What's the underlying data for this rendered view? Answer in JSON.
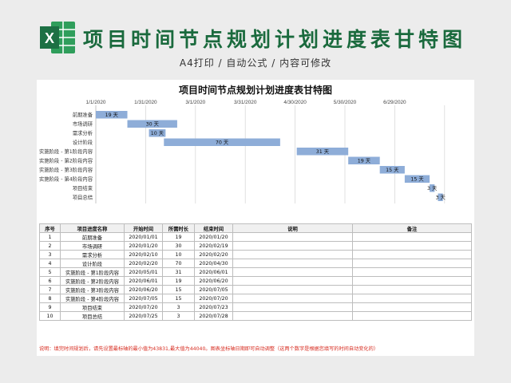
{
  "header": {
    "title": "项目时间节点规划计划进度表甘特图",
    "subtitle": "A4打印 / 自动公式 / 内容可修改",
    "logo_letter": "X"
  },
  "chart_data": {
    "type": "bar",
    "title": "项目时间节点规划计划进度表甘特图",
    "x_ticks": [
      "1/1/2020",
      "1/31/2020",
      "3/1/2020",
      "3/31/2020",
      "4/30/2020",
      "5/30/2020",
      "6/29/2020"
    ],
    "x_tick_days": [
      0,
      30,
      60,
      90,
      120,
      150,
      180
    ],
    "x_max_day": 210,
    "grid": true,
    "bar_color": "#8eadd8",
    "label_suffix": " 天",
    "categories": [
      "前期准备",
      "市场调研",
      "需求分析",
      "设计阶段",
      "实施阶段 - 第1阶段内容",
      "实施阶段 - 第2阶段内容",
      "实施阶段 - 第3阶段内容",
      "实施阶段 - 第4阶段内容",
      "项目结束",
      "项目总结"
    ],
    "start_days": [
      0,
      19,
      32,
      41,
      121,
      152,
      171,
      186,
      201,
      206
    ],
    "durations": [
      19,
      30,
      10,
      70,
      31,
      19,
      15,
      15,
      3,
      3
    ]
  },
  "table": {
    "headers": [
      "序号",
      "项目进度名称",
      "开始时间",
      "所需时长",
      "结束时间",
      "说明",
      "备注"
    ],
    "rows": [
      [
        "1",
        "前期准备",
        "2020/01/01",
        "19",
        "2020/01/20",
        "",
        ""
      ],
      [
        "2",
        "市场调研",
        "2020/01/20",
        "30",
        "2020/02/19",
        "",
        ""
      ],
      [
        "3",
        "需求分析",
        "2020/02/10",
        "10",
        "2020/02/20",
        "",
        ""
      ],
      [
        "4",
        "设计阶段",
        "2020/02/20",
        "70",
        "2020/04/30",
        "",
        ""
      ],
      [
        "5",
        "实施阶段 - 第1阶段内容",
        "2020/05/01",
        "31",
        "2020/06/01",
        "",
        ""
      ],
      [
        "6",
        "实施阶段 - 第2阶段内容",
        "2020/06/01",
        "19",
        "2020/06/20",
        "",
        ""
      ],
      [
        "7",
        "实施阶段 - 第3阶段内容",
        "2020/06/20",
        "15",
        "2020/07/05",
        "",
        ""
      ],
      [
        "8",
        "实施阶段 - 第4阶段内容",
        "2020/07/05",
        "15",
        "2020/07/20",
        "",
        ""
      ],
      [
        "9",
        "项目结束",
        "2020/07/20",
        "3",
        "2020/07/23",
        "",
        ""
      ],
      [
        "10",
        "项目总结",
        "2020/07/25",
        "3",
        "2020/07/28",
        "",
        ""
      ]
    ]
  },
  "note": "说明：填完时间规划后，请先设置最标轴的最小值为43831,最大值为44040。图表坐标轴日期即可自动调整（这两个数字是根据您填写的时间自动变化的）"
}
